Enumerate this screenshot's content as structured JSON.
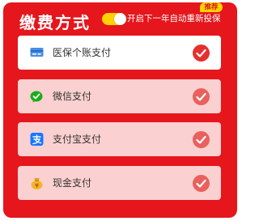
{
  "header": {
    "title": "缴费方式",
    "auto_renew_label": "开启下一年自动重新投保",
    "auto_renew_on": true,
    "badge": "推荐"
  },
  "colors": {
    "panel": "#e5161c",
    "toggle": "#ffd200",
    "selected_row": "#ffffff",
    "row": "#fbd0d0",
    "check": "#e6302d"
  },
  "options": [
    {
      "label": "医保个账支付",
      "icon": "medical-card-icon",
      "selected": true
    },
    {
      "label": "微信支付",
      "icon": "wechat-icon",
      "selected": false
    },
    {
      "label": "支付宝支付",
      "icon": "alipay-icon",
      "selected": false
    },
    {
      "label": "现金支付",
      "icon": "cash-bag-icon",
      "selected": false
    }
  ]
}
